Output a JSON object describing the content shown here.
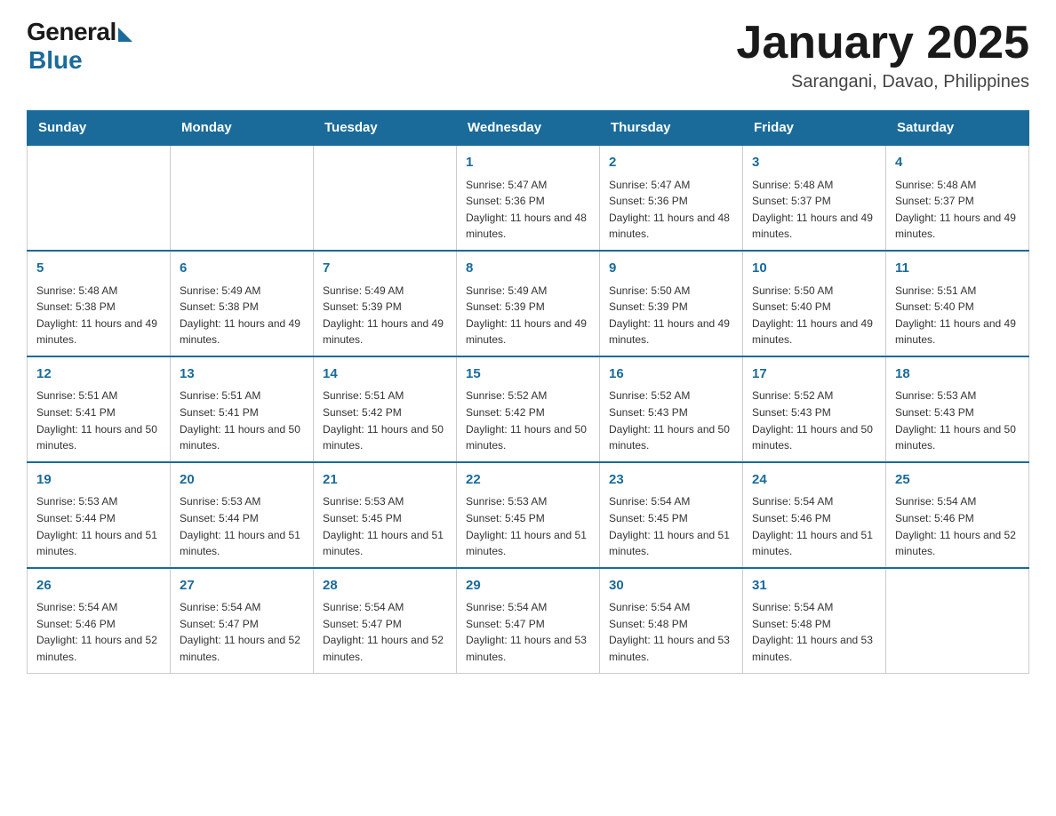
{
  "logo": {
    "general": "General",
    "blue": "Blue"
  },
  "title": "January 2025",
  "location": "Sarangani, Davao, Philippines",
  "days_of_week": [
    "Sunday",
    "Monday",
    "Tuesday",
    "Wednesday",
    "Thursday",
    "Friday",
    "Saturday"
  ],
  "weeks": [
    [
      {
        "day": "",
        "info": ""
      },
      {
        "day": "",
        "info": ""
      },
      {
        "day": "",
        "info": ""
      },
      {
        "day": "1",
        "info": "Sunrise: 5:47 AM\nSunset: 5:36 PM\nDaylight: 11 hours and 48 minutes."
      },
      {
        "day": "2",
        "info": "Sunrise: 5:47 AM\nSunset: 5:36 PM\nDaylight: 11 hours and 48 minutes."
      },
      {
        "day": "3",
        "info": "Sunrise: 5:48 AM\nSunset: 5:37 PM\nDaylight: 11 hours and 49 minutes."
      },
      {
        "day": "4",
        "info": "Sunrise: 5:48 AM\nSunset: 5:37 PM\nDaylight: 11 hours and 49 minutes."
      }
    ],
    [
      {
        "day": "5",
        "info": "Sunrise: 5:48 AM\nSunset: 5:38 PM\nDaylight: 11 hours and 49 minutes."
      },
      {
        "day": "6",
        "info": "Sunrise: 5:49 AM\nSunset: 5:38 PM\nDaylight: 11 hours and 49 minutes."
      },
      {
        "day": "7",
        "info": "Sunrise: 5:49 AM\nSunset: 5:39 PM\nDaylight: 11 hours and 49 minutes."
      },
      {
        "day": "8",
        "info": "Sunrise: 5:49 AM\nSunset: 5:39 PM\nDaylight: 11 hours and 49 minutes."
      },
      {
        "day": "9",
        "info": "Sunrise: 5:50 AM\nSunset: 5:39 PM\nDaylight: 11 hours and 49 minutes."
      },
      {
        "day": "10",
        "info": "Sunrise: 5:50 AM\nSunset: 5:40 PM\nDaylight: 11 hours and 49 minutes."
      },
      {
        "day": "11",
        "info": "Sunrise: 5:51 AM\nSunset: 5:40 PM\nDaylight: 11 hours and 49 minutes."
      }
    ],
    [
      {
        "day": "12",
        "info": "Sunrise: 5:51 AM\nSunset: 5:41 PM\nDaylight: 11 hours and 50 minutes."
      },
      {
        "day": "13",
        "info": "Sunrise: 5:51 AM\nSunset: 5:41 PM\nDaylight: 11 hours and 50 minutes."
      },
      {
        "day": "14",
        "info": "Sunrise: 5:51 AM\nSunset: 5:42 PM\nDaylight: 11 hours and 50 minutes."
      },
      {
        "day": "15",
        "info": "Sunrise: 5:52 AM\nSunset: 5:42 PM\nDaylight: 11 hours and 50 minutes."
      },
      {
        "day": "16",
        "info": "Sunrise: 5:52 AM\nSunset: 5:43 PM\nDaylight: 11 hours and 50 minutes."
      },
      {
        "day": "17",
        "info": "Sunrise: 5:52 AM\nSunset: 5:43 PM\nDaylight: 11 hours and 50 minutes."
      },
      {
        "day": "18",
        "info": "Sunrise: 5:53 AM\nSunset: 5:43 PM\nDaylight: 11 hours and 50 minutes."
      }
    ],
    [
      {
        "day": "19",
        "info": "Sunrise: 5:53 AM\nSunset: 5:44 PM\nDaylight: 11 hours and 51 minutes."
      },
      {
        "day": "20",
        "info": "Sunrise: 5:53 AM\nSunset: 5:44 PM\nDaylight: 11 hours and 51 minutes."
      },
      {
        "day": "21",
        "info": "Sunrise: 5:53 AM\nSunset: 5:45 PM\nDaylight: 11 hours and 51 minutes."
      },
      {
        "day": "22",
        "info": "Sunrise: 5:53 AM\nSunset: 5:45 PM\nDaylight: 11 hours and 51 minutes."
      },
      {
        "day": "23",
        "info": "Sunrise: 5:54 AM\nSunset: 5:45 PM\nDaylight: 11 hours and 51 minutes."
      },
      {
        "day": "24",
        "info": "Sunrise: 5:54 AM\nSunset: 5:46 PM\nDaylight: 11 hours and 51 minutes."
      },
      {
        "day": "25",
        "info": "Sunrise: 5:54 AM\nSunset: 5:46 PM\nDaylight: 11 hours and 52 minutes."
      }
    ],
    [
      {
        "day": "26",
        "info": "Sunrise: 5:54 AM\nSunset: 5:46 PM\nDaylight: 11 hours and 52 minutes."
      },
      {
        "day": "27",
        "info": "Sunrise: 5:54 AM\nSunset: 5:47 PM\nDaylight: 11 hours and 52 minutes."
      },
      {
        "day": "28",
        "info": "Sunrise: 5:54 AM\nSunset: 5:47 PM\nDaylight: 11 hours and 52 minutes."
      },
      {
        "day": "29",
        "info": "Sunrise: 5:54 AM\nSunset: 5:47 PM\nDaylight: 11 hours and 53 minutes."
      },
      {
        "day": "30",
        "info": "Sunrise: 5:54 AM\nSunset: 5:48 PM\nDaylight: 11 hours and 53 minutes."
      },
      {
        "day": "31",
        "info": "Sunrise: 5:54 AM\nSunset: 5:48 PM\nDaylight: 11 hours and 53 minutes."
      },
      {
        "day": "",
        "info": ""
      }
    ]
  ],
  "colors": {
    "header_bg": "#1a6b9a",
    "header_text": "#ffffff",
    "day_number": "#1a6b9a",
    "border": "#cccccc"
  }
}
